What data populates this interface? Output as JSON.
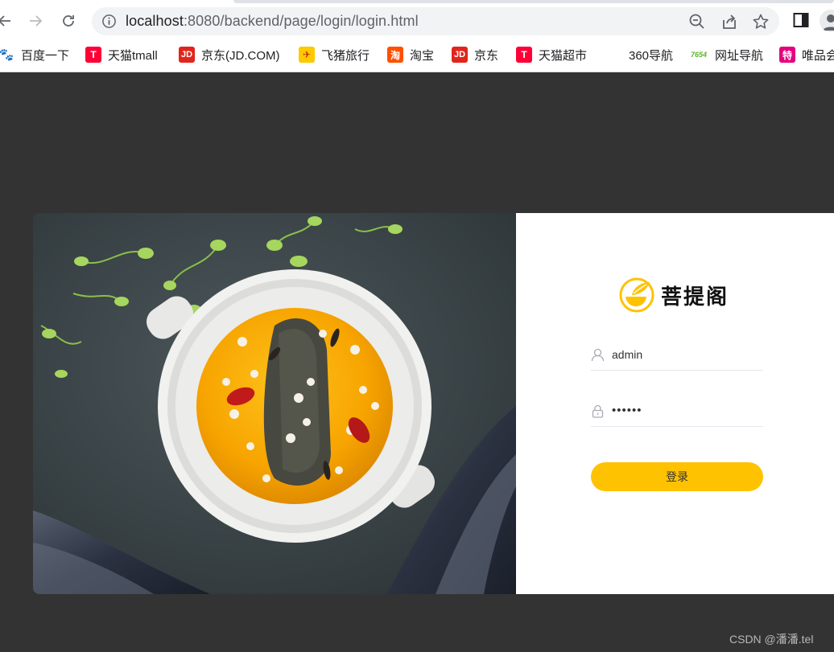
{
  "browser": {
    "url_host": "localhost",
    "url_path": ":8080/backend/page/login/login.html",
    "bookmarks": [
      {
        "label": "百度一下",
        "icon": "baidu-paw-icon",
        "color": "#2932e1",
        "glyph": "🐾"
      },
      {
        "label": "天猫tmall",
        "icon": "tmall-icon",
        "color": "#ff0036",
        "glyph": "T"
      },
      {
        "label": "京东(JD.COM)",
        "icon": "jd-icon",
        "color": "#e1251b",
        "glyph": "JD"
      },
      {
        "label": "飞猪旅行",
        "icon": "fliggy-icon",
        "color": "#ffc900",
        "glyph": "✈"
      },
      {
        "label": "淘宝",
        "icon": "taobao-icon",
        "color": "#ff5000",
        "glyph": "淘"
      },
      {
        "label": "京东",
        "icon": "jd-icon",
        "color": "#e1251b",
        "glyph": "JD"
      },
      {
        "label": "天猫超市",
        "icon": "tmall-icon",
        "color": "#ff0036",
        "glyph": "T"
      },
      {
        "label": "360导航",
        "icon": "",
        "color": "",
        "glyph": ""
      },
      {
        "label": "网址导航",
        "icon": "7654-icon",
        "color": "#5cb531",
        "glyph": "7654"
      },
      {
        "label": "唯品会",
        "icon": "vip-icon",
        "color": "#e4007f",
        "glyph": "特"
      }
    ]
  },
  "login": {
    "brand_name": "菩提阁",
    "username_value": "admin",
    "password_value": "••••••",
    "submit_label": "登录"
  },
  "colors": {
    "page_bg": "#333333",
    "accent": "#ffc200"
  },
  "watermark": "CSDN @潘潘.tel"
}
